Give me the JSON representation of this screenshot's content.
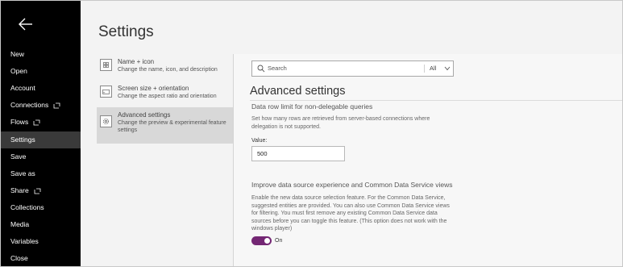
{
  "nav": {
    "items": [
      {
        "label": "New"
      },
      {
        "label": "Open"
      },
      {
        "label": "Account"
      },
      {
        "label": "Connections"
      },
      {
        "label": "Flows"
      },
      {
        "label": "Settings"
      },
      {
        "label": "Save"
      },
      {
        "label": "Save as"
      },
      {
        "label": "Share"
      },
      {
        "label": "Collections"
      },
      {
        "label": "Media"
      },
      {
        "label": "Variables"
      },
      {
        "label": "Close"
      }
    ]
  },
  "page": {
    "title": "Settings"
  },
  "categories": [
    {
      "title": "Name + icon",
      "desc": "Change the name, icon, and description",
      "icon": "name-icon-icon"
    },
    {
      "title": "Screen size + orientation",
      "desc": "Change the aspect ratio and orientation",
      "icon": "screen-size-icon"
    },
    {
      "title": "Advanced settings",
      "desc": "Change the preview & experimental feature settings",
      "icon": "gear-icon"
    }
  ],
  "search": {
    "placeholder": "Search",
    "scope": "All"
  },
  "advanced": {
    "title": "Advanced settings",
    "row_limit": {
      "title": "Data row limit for non-delegable queries",
      "desc": "Set how many rows are retrieved from server-based connections where delegation is not supported.",
      "value_label": "Value:",
      "value": "500"
    },
    "cds": {
      "title": "Improve data source experience and Common Data Service views",
      "desc": "Enable the new data source selection feature. For the Common Data Service, suggested entities are provided. You can also use Common Data Service views for filtering. You must first remove any existing Common Data Service data sources before you can toggle this feature. (This option does not work with the windows player)",
      "toggle_label": "On",
      "toggle_on": true
    }
  },
  "colors": {
    "nav_bg": "#000000",
    "active_nav": "#3a3a3a",
    "toggle_accent": "#742774"
  }
}
